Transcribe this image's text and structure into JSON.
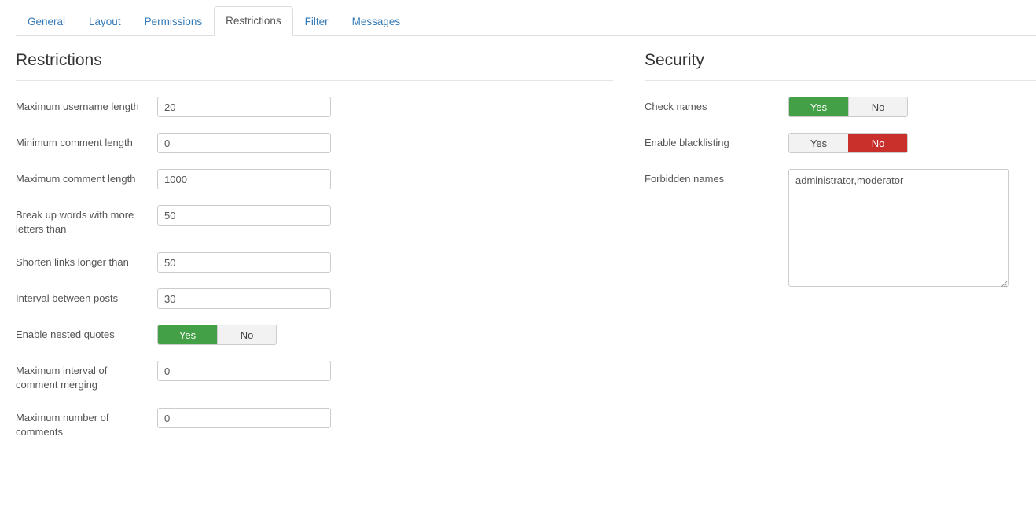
{
  "tabs": [
    {
      "label": "General",
      "active": false
    },
    {
      "label": "Layout",
      "active": false
    },
    {
      "label": "Permissions",
      "active": false
    },
    {
      "label": "Restrictions",
      "active": true
    },
    {
      "label": "Filter",
      "active": false
    },
    {
      "label": "Messages",
      "active": false
    }
  ],
  "restrictions": {
    "title": "Restrictions",
    "fields": [
      {
        "label": "Maximum username length",
        "type": "text",
        "value": "20"
      },
      {
        "label": "Minimum comment length",
        "type": "text",
        "value": "0"
      },
      {
        "label": "Maximum comment length",
        "type": "text",
        "value": "1000"
      },
      {
        "label": "Break up words with more letters than",
        "type": "text",
        "value": "50"
      },
      {
        "label": "Shorten links longer than",
        "type": "text",
        "value": "50"
      },
      {
        "label": "Interval between posts",
        "type": "text",
        "value": "30"
      },
      {
        "label": "Enable nested quotes",
        "type": "toggle",
        "yes_label": "Yes",
        "no_label": "No",
        "value": "Yes"
      },
      {
        "label": "Maximum interval of comment merging",
        "type": "text",
        "value": "0"
      },
      {
        "label": "Maximum number of comments",
        "type": "text",
        "value": "0"
      }
    ]
  },
  "security": {
    "title": "Security",
    "fields": [
      {
        "label": "Check names",
        "type": "toggle",
        "yes_label": "Yes",
        "no_label": "No",
        "value": "Yes"
      },
      {
        "label": "Enable blacklisting",
        "type": "toggle",
        "yes_label": "Yes",
        "no_label": "No",
        "value": "No"
      },
      {
        "label": "Forbidden names",
        "type": "textarea",
        "value": "administrator,moderator"
      }
    ]
  },
  "colors": {
    "tab_link": "#337ab7",
    "tab_active_text": "#555555",
    "toggle_yes_active": "#44a047",
    "toggle_no_active": "#c9302c",
    "toggle_inactive_bg": "#f2f2f2",
    "border": "#cccccc",
    "label_text": "#555555"
  }
}
